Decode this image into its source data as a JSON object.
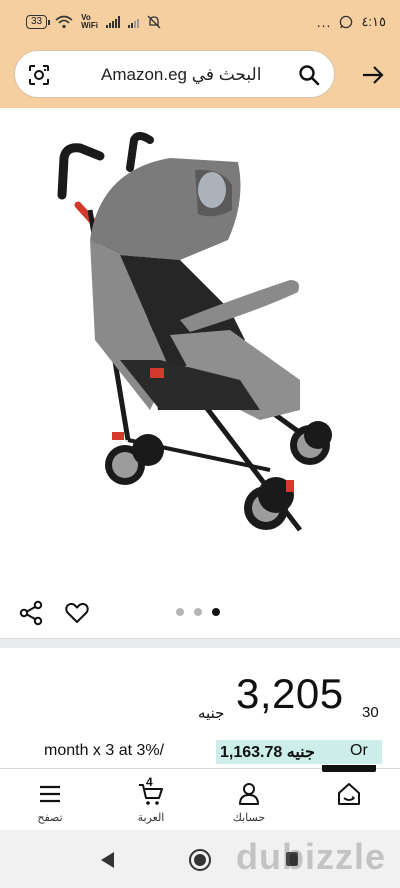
{
  "status_bar": {
    "battery": "33",
    "network_label": "Vo\nWiFi",
    "time": "٤:١٥",
    "overflow": "..."
  },
  "header": {
    "search_text": "البحث في Amazon.eg",
    "icons": [
      "camera-lens-icon",
      "search-icon",
      "back-arrow-icon"
    ]
  },
  "product": {
    "image_alt": "baby-stroller",
    "carousel": {
      "total": 3,
      "active_index": 3
    }
  },
  "price": {
    "whole": "3,205",
    "fraction": "30",
    "currency": "جنيه"
  },
  "installment": {
    "text": "month x 3 at 3%/",
    "amount": "1,163.78 جنيه",
    "or": "Or"
  },
  "bottom_nav": {
    "items": [
      {
        "label": "تصفح",
        "icon": "menu-icon"
      },
      {
        "label": "العربة",
        "icon": "cart-icon",
        "badge": "4"
      },
      {
        "label": "حسابك",
        "icon": "user-icon"
      },
      {
        "label": "",
        "icon": "home-icon"
      }
    ]
  },
  "watermark": "dubizzle",
  "colors": {
    "header_bg": "#f5cfa0",
    "installment_highlight": "#cdeee8",
    "text": "#0f1111"
  }
}
